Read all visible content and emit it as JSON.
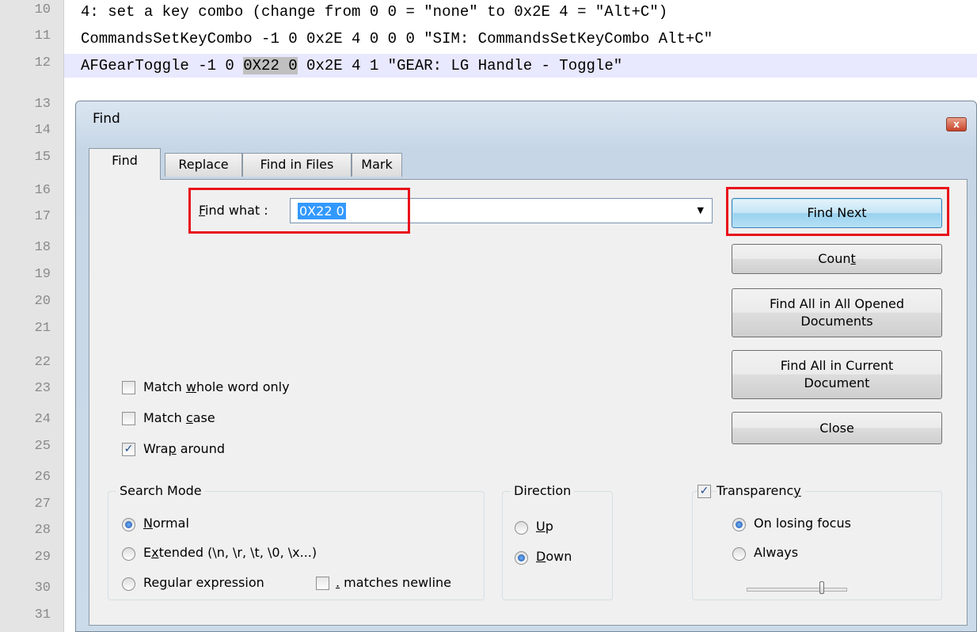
{
  "editor": {
    "line_numbers": [
      "10",
      "11",
      "12",
      "13",
      "14",
      "15",
      "16",
      "17",
      "18",
      "19",
      "20",
      "21",
      "22",
      "23",
      "24",
      "25",
      "26",
      "27",
      "28",
      "29",
      "30",
      "31"
    ],
    "lines": [
      "4: set a key combo (change from 0 0 = \"none\" to 0x2E 4 = \"Alt+C\")",
      "CommandsSetKeyCombo -1 0 0x2E 4 0 0 0 \"SIM: CommandsSetKeyCombo Alt+C\"",
      {
        "before": "AFGearToggle -1 0 ",
        "match": "0X22 0",
        "after": " 0x2E 4 1 \"GEAR: LG Handle - Toggle\""
      }
    ]
  },
  "dialog": {
    "title": "Find",
    "close_glyph": "x",
    "tabs": [
      "Find",
      "Replace",
      "Find in Files",
      "Mark"
    ],
    "find_what_label": {
      "pre": "",
      "u": "F",
      "post": "ind what :"
    },
    "find_what_value": "0X22 0",
    "buttons": {
      "find_next": "Find Next",
      "count": {
        "pre": "Coun",
        "u": "t",
        "post": ""
      },
      "find_all_opened": {
        "line1": "Find All in All Opened",
        "line2": "Documents"
      },
      "find_all_current": {
        "line1": "Find All in Current",
        "line2": "Document"
      },
      "close": "Close"
    },
    "options": {
      "match_whole_word": {
        "pre": "Match ",
        "u": "w",
        "post": "hole word only",
        "checked": false
      },
      "match_case": {
        "pre": "Match ",
        "u": "c",
        "post": "ase",
        "checked": false
      },
      "wrap_around": {
        "pre": "Wra",
        "u": "p",
        "post": " around",
        "checked": true
      }
    },
    "search_mode": {
      "title": "Search Mode",
      "normal": {
        "pre": "",
        "u": "N",
        "post": "ormal",
        "selected": true
      },
      "extended": {
        "pre": "E",
        "u": "x",
        "post": "tended (\\n, \\r, \\t, \\0, \\x...)",
        "selected": false
      },
      "regex": {
        "pre": "Re",
        "u": "g",
        "post": "ular expression",
        "selected": false
      },
      "matches_newline": {
        "u": ".",
        "post": " matches newline",
        "checked": false
      }
    },
    "direction": {
      "title": "Direction",
      "up": {
        "u": "U",
        "post": "p",
        "selected": false
      },
      "down": {
        "u": "D",
        "post": "own",
        "selected": true
      }
    },
    "transparency": {
      "title": {
        "pre": "Transparenc",
        "u": "y",
        "post": ""
      },
      "checked": true,
      "on_losing_focus": {
        "label": "On losing focus",
        "selected": true
      },
      "always": {
        "label": "Always",
        "selected": false
      },
      "slider_level": 0.74
    }
  },
  "annotation_color": "#e8121b"
}
